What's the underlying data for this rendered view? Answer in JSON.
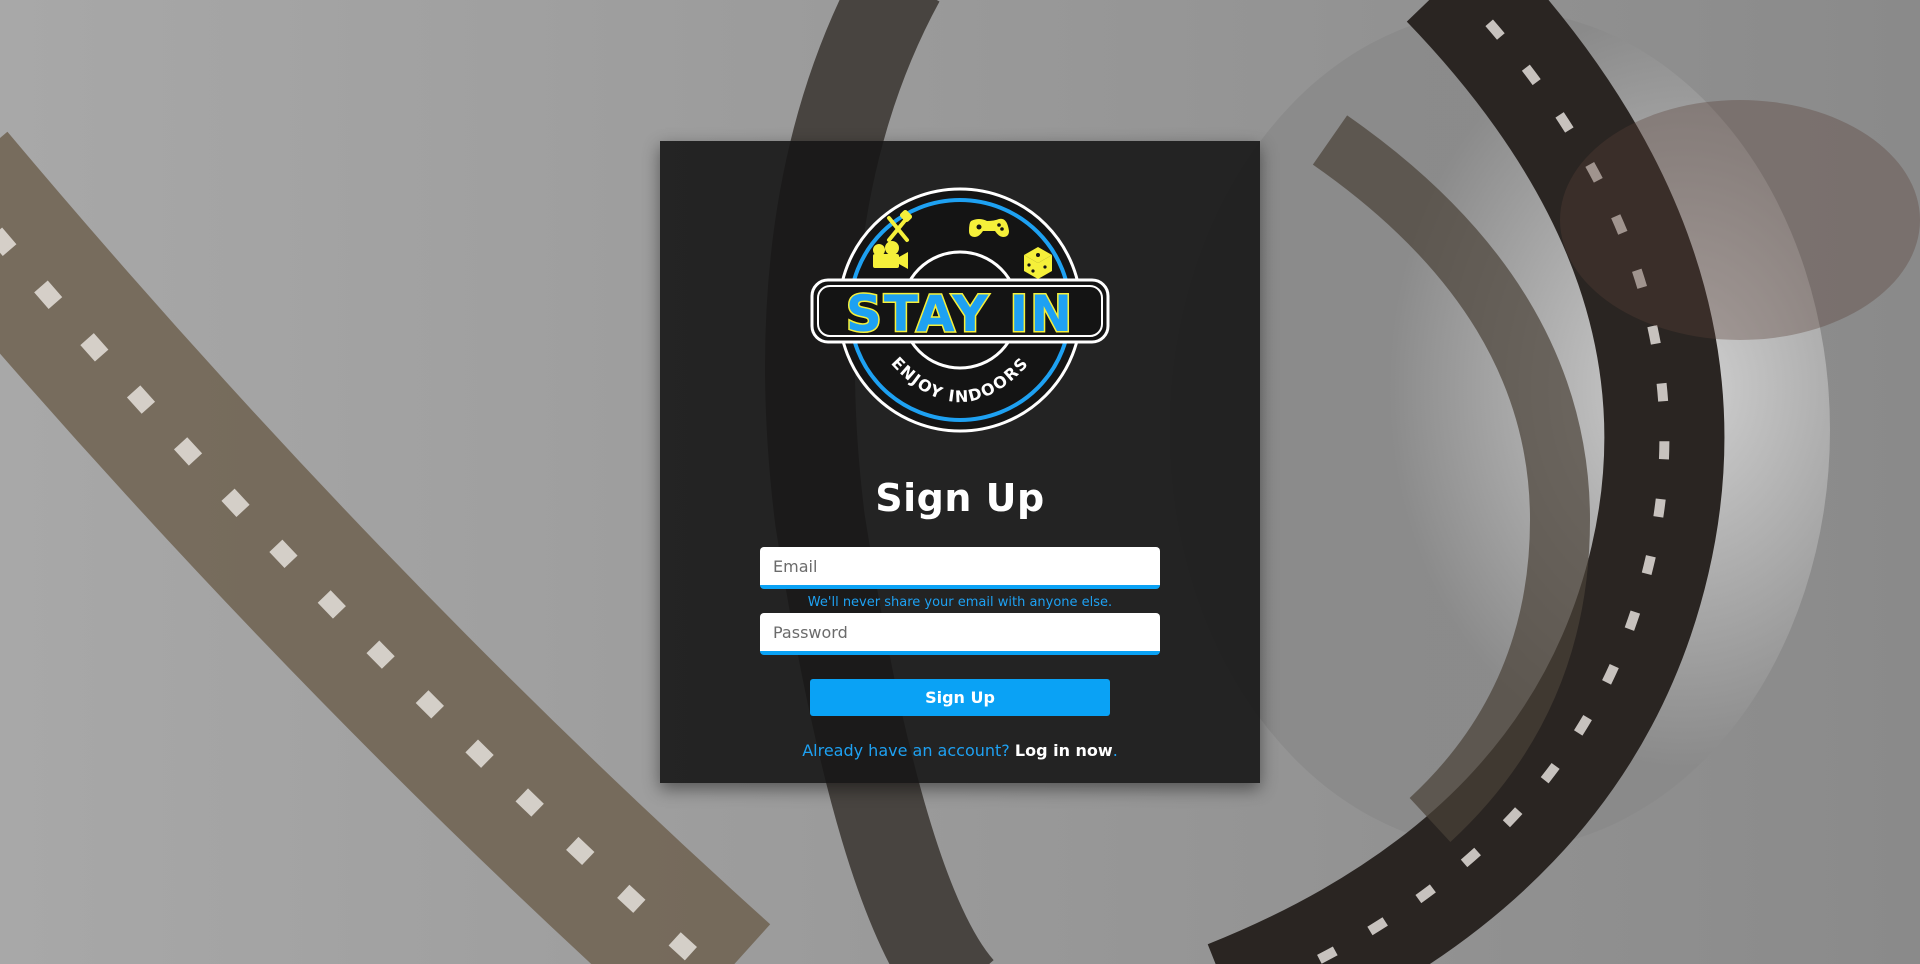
{
  "logo": {
    "brand_text": "STAY IN",
    "tagline": "ENJOY INDOORS",
    "icons": [
      "fork-spatula-icon",
      "gamepad-icon",
      "movie-camera-icon",
      "dice-icon"
    ],
    "colors": {
      "ring": "#1ea1f2",
      "text_fill": "#1ea1f2",
      "text_outline": "#f5f03a",
      "icons": "#f5f03a"
    }
  },
  "form": {
    "title": "Sign Up",
    "email": {
      "placeholder": "Email",
      "value": ""
    },
    "email_help": "We'll never share your email with anyone else.",
    "password": {
      "placeholder": "Password",
      "value": ""
    },
    "submit_label": "Sign Up",
    "footer_question": "Already have an account?",
    "footer_link": "Log in now",
    "footer_period": "."
  },
  "colors": {
    "accent": "#0aa2f5",
    "card_background": "#161616",
    "page_background": "#8c8c8c"
  },
  "background": {
    "icon": "film-strip-background"
  }
}
